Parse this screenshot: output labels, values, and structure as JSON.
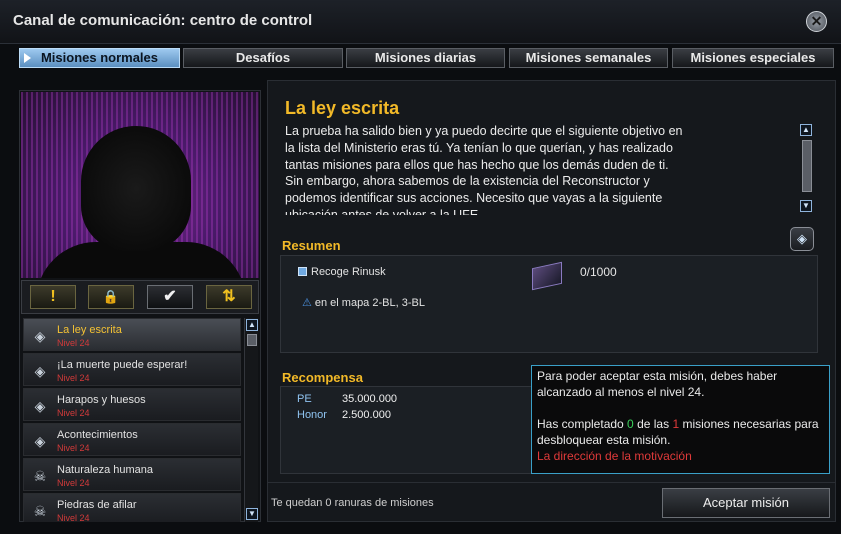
{
  "window": {
    "title": "Canal de comunicación: centro de control",
    "close_icon": "close-icon"
  },
  "tabs": [
    {
      "label": "Misiones normales",
      "active": true
    },
    {
      "label": "Desafíos"
    },
    {
      "label": "Misiones diarias"
    },
    {
      "label": "Misiones semanales"
    },
    {
      "label": "Misiones especiales"
    }
  ],
  "filters": [
    {
      "icon": "exclamation-icon",
      "glyph": "!"
    },
    {
      "icon": "lock-icon",
      "glyph": "🔒"
    },
    {
      "icon": "checkmark-icon",
      "glyph": "✔"
    },
    {
      "icon": "sort-arrows-icon",
      "glyph": "⇅"
    }
  ],
  "missions": [
    {
      "name": "La ley escrita",
      "level": "Nivel 24",
      "icon": "diamond-icon",
      "selected": true
    },
    {
      "name": "¡La muerte puede esperar!",
      "level": "Nivel 24",
      "icon": "diamond-icon"
    },
    {
      "name": "Harapos y huesos",
      "level": "Nivel 24",
      "icon": "diamond-icon"
    },
    {
      "name": "Acontecimientos",
      "level": "Nivel 24",
      "icon": "diamond-icon"
    },
    {
      "name": "Naturaleza humana",
      "level": "Nivel 24",
      "icon": "skull-icon"
    },
    {
      "name": "Piedras de afilar",
      "level": "Nivel 24",
      "icon": "skull-icon"
    }
  ],
  "detail": {
    "title": "La ley escrita",
    "description": "La prueba ha salido bien y ya puedo decirte que el siguiente objetivo en la lista del Ministerio eras tú. Ya tenían lo que querían, y has realizado tantas misiones para ellos que has hecho que los demás duden de ti. Sin embargo, ahora sabemos de la existencia del Reconstructor y podemos identificar sus acciones. Necesito que vayas a la siguiente ubicación antes de volver a la UFE."
  },
  "summary": {
    "heading": "Resumen",
    "objective": "Recoge Rinusk",
    "progress": "0/1000",
    "location": "en el mapa 2-BL, 3-BL"
  },
  "reward": {
    "heading": "Recompensa",
    "rows": [
      {
        "label": "PE",
        "value": "35.000.000"
      },
      {
        "label": "Honor",
        "value": "2.500.000"
      }
    ]
  },
  "tooltip": {
    "line1": "Para poder aceptar esta misión, debes haber alcanzado al menos el nivel 24.",
    "pre": "Has completado ",
    "done": "0",
    "mid": " de las ",
    "needed": "1",
    "post": " misiones necesarias para desbloquear esta misión.",
    "requirement": "La dirección de la motivación"
  },
  "footer": {
    "slots": "Te quedan 0 ranuras de misiones",
    "accept": "Aceptar misión"
  }
}
